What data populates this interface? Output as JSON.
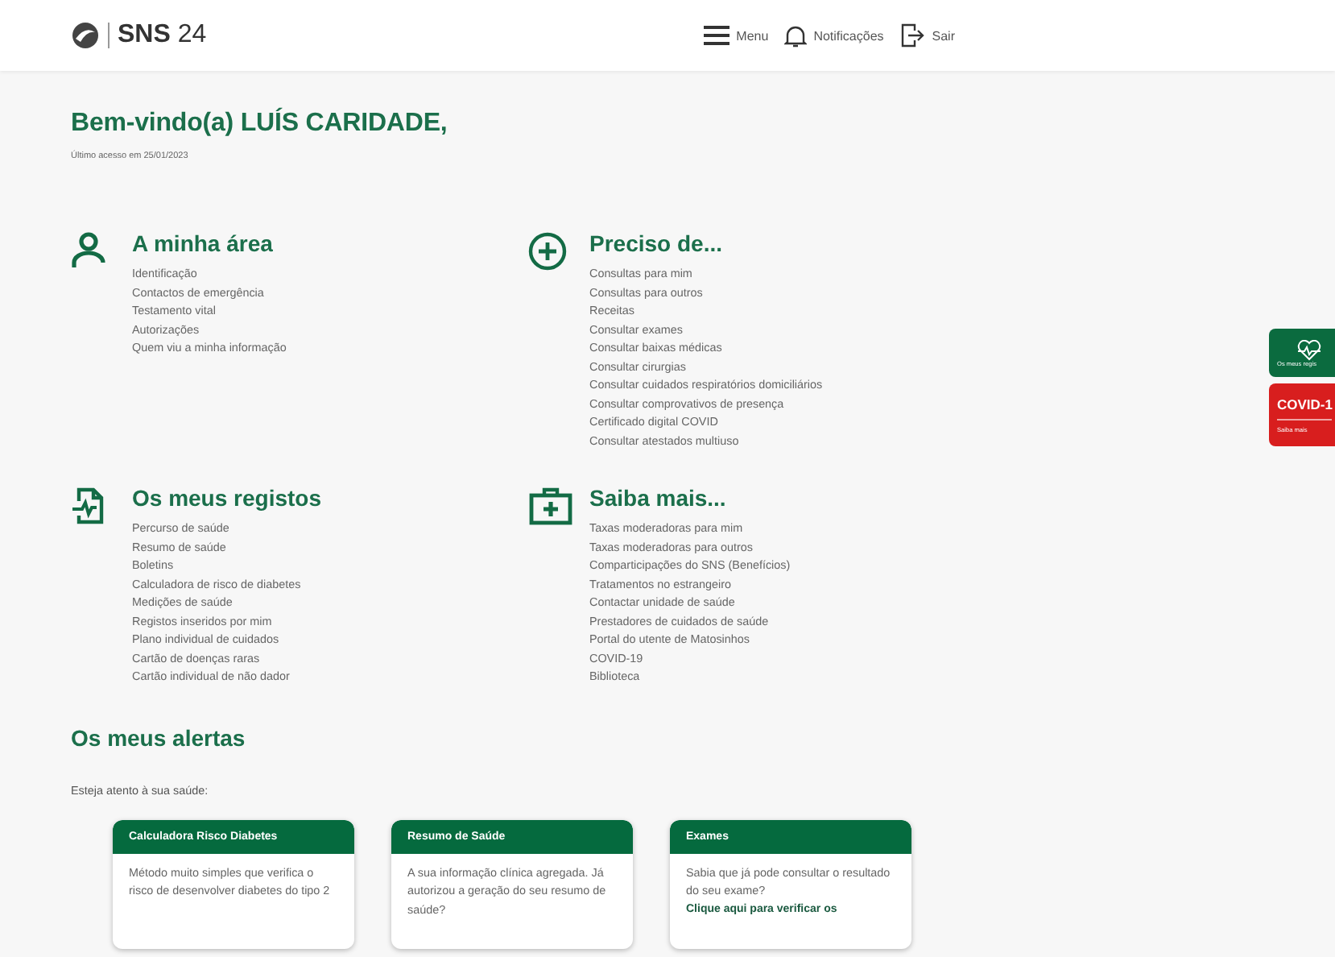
{
  "header": {
    "logo": "SNS",
    "logo_number": "24",
    "menu": "Menu",
    "notifications": "Notificações",
    "logout": "Sair"
  },
  "welcome": {
    "title": "Bem-vindo(a) LUÍS CARIDADE,",
    "last_access": "Último acesso em 25/01/2023"
  },
  "sections": [
    {
      "kind": "person",
      "title": "A minha área",
      "items": [
        "Identificação",
        "Contactos de emergência",
        "Testamento vital",
        "Autorizações",
        "Quem viu a minha informação"
      ]
    },
    {
      "kind": "plus",
      "title": "Preciso de...",
      "items": [
        "Consultas para mim",
        "Consultas para outros",
        "Receitas",
        "Consultar exames",
        "Consultar baixas médicas",
        "Consultar cirurgias",
        "Consultar cuidados respiratórios domiciliários",
        "Consultar comprovativos de presença",
        "Certificado digital COVID",
        "Consultar atestados multiuso"
      ]
    },
    {
      "kind": "record",
      "title": "Os meus registos",
      "items": [
        "Percurso de saúde",
        "Resumo de saúde",
        "Boletins",
        "Calculadora de risco de diabetes",
        "Medições de saúde",
        "Registos inseridos por mim",
        "Plano individual de cuidados",
        "Cartão de doenças raras",
        "Cartão individual de não dador"
      ]
    },
    {
      "kind": "kit",
      "title": "Saiba mais...",
      "items": [
        "Taxas moderadoras para mim",
        "Taxas moderadoras para outros",
        "Comparticipações do SNS (Benefícios)",
        "Tratamentos no estrangeiro",
        "Contactar unidade de saúde",
        "Prestadores de cuidados de saúde",
        "Portal do utente de Matosinhos",
        "COVID-19",
        "Biblioteca"
      ]
    }
  ],
  "alerts": {
    "title": "Os meus alertas",
    "intro": "Esteja atento à sua saúde:",
    "cards": [
      {
        "title": "Calculadora Risco Diabetes",
        "text": "Método muito simples que verifica o risco de desenvolver diabetes do tipo 2"
      },
      {
        "title": "Resumo de Saúde",
        "text": "A sua informação clínica agregada. Já autorizou a geração do seu resumo de saúde?"
      },
      {
        "title": "Exames",
        "text": "Sabia que já pode consultar o resultado do seu exame?",
        "link": "Clique aqui para verificar os"
      }
    ]
  },
  "side_tabs": [
    {
      "kind": "records",
      "label": "Os meus regis",
      "color": "#0b6b3f"
    },
    {
      "kind": "covid",
      "label": "COVID-1",
      "sub": "Saiba mais",
      "color": "#d81e1e"
    }
  ]
}
